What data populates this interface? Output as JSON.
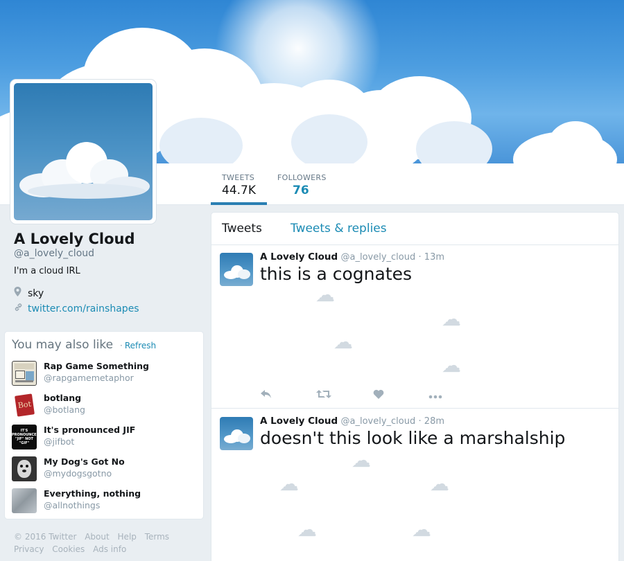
{
  "profile": {
    "name": "A Lovely Cloud",
    "handle": "@a_lovely_cloud",
    "bio": "I'm a cloud IRL",
    "location": "sky",
    "link": "twitter.com/rainshapes"
  },
  "stats": {
    "tweets_label": "TWEETS",
    "tweets_value": "44.7K",
    "followers_label": "FOLLOWERS",
    "followers_value": "76"
  },
  "suggestions": {
    "title": "You may also like",
    "separator": "·",
    "refresh": "Refresh",
    "items": [
      {
        "name": "Rap Game Something",
        "handle": "@rapgamemetaphor"
      },
      {
        "name": "botlang",
        "handle": "@botlang"
      },
      {
        "name": "It's pronounced JIF",
        "handle": "@jifbot"
      },
      {
        "name": "My Dog's Got No",
        "handle": "@mydogsgotno"
      },
      {
        "name": "Everything, nothing",
        "handle": "@allnothings"
      }
    ]
  },
  "avatar_text": {
    "botlang": "Bot",
    "jifbot": "IT'S PRONOUNCED \"JIF\" NOT \"GIF\""
  },
  "footer": {
    "links": [
      "© 2016 Twitter",
      "About",
      "Help",
      "Terms",
      "Privacy",
      "Cookies",
      "Ads info"
    ]
  },
  "timeline": {
    "tabs": [
      "Tweets",
      "Tweets & replies"
    ],
    "tweets": [
      {
        "name": "A Lovely Cloud",
        "handle": "@a_lovely_cloud",
        "time": "· 13m",
        "text": "this is a cognates"
      },
      {
        "name": "A Lovely Cloud",
        "handle": "@a_lovely_cloud",
        "time": "· 28m",
        "text": "doesn't this look like a marshalship"
      }
    ]
  },
  "icons": {
    "location": "location-pin-icon",
    "link": "link-icon",
    "reply": "reply-icon",
    "retweet": "retweet-icon",
    "like": "heart-icon",
    "more": "more-icon"
  },
  "colors": {
    "link": "#1b8bb4",
    "tab_underline": "#2a7fb3",
    "background": "#e9eef2"
  }
}
